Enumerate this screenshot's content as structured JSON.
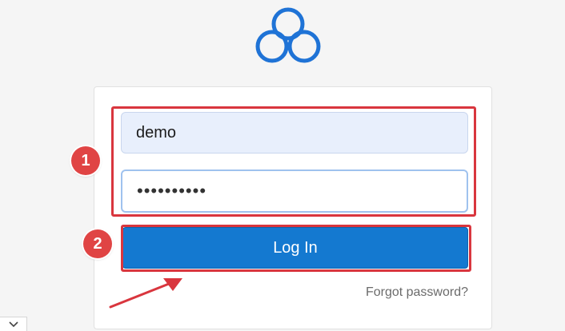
{
  "login_form": {
    "username_value": "demo",
    "password_value": "••••••••••",
    "login_button_label": "Log In",
    "forgot_password_label": "Forgot password?"
  },
  "annotations": {
    "badge_1": "1",
    "badge_2": "2",
    "highlight_color": "#d9363e"
  },
  "icons": {
    "logo": "cloud-logo-icon",
    "arrow": "pointer-arrow-icon",
    "chevron": "chevron-down-icon"
  },
  "colors": {
    "brand_blue": "#1479d0",
    "logo_blue": "#1f73d6",
    "badge_red": "#e04444"
  }
}
